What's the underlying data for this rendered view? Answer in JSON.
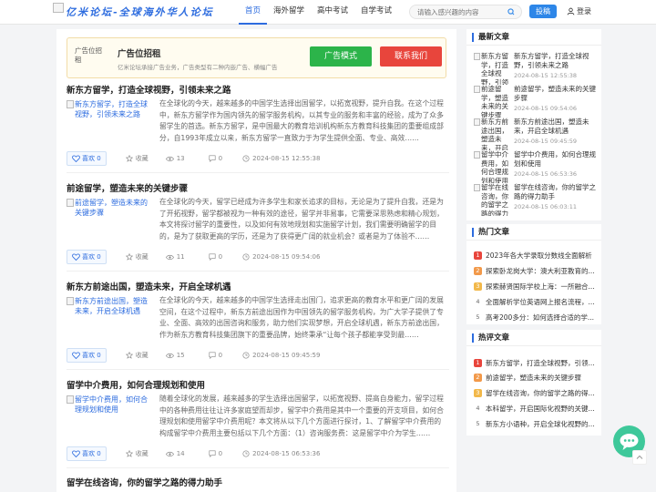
{
  "header": {
    "logo_text": "亿米论坛-全球海外华人论坛",
    "nav": [
      {
        "label": "首页",
        "active": true
      },
      {
        "label": "海外留学",
        "active": false
      },
      {
        "label": "高中考试",
        "active": false
      },
      {
        "label": "自学考试",
        "active": false
      }
    ],
    "search_placeholder": "请输入感兴趣的内容",
    "post_label": "投稿",
    "login_label": "登录"
  },
  "ad": {
    "image_alt": "广告位招租",
    "title": "广告位招租",
    "desc": "亿米论坛承接广告业务，广告类型有二种内嵌广告、横幅广告",
    "btn_mode": "广告模式",
    "btn_contact": "联系我们"
  },
  "articles": [
    {
      "title": "新东方留学，打造全球视野，引领未来之路",
      "image_alt": "新东方留学，打造全球视野，引领未来之路",
      "summary": "在全球化的今天，越来越多的中国学生选择出国留学，以拓宽视野，提升自我。在这个过程中，新东方留学作为国内领先的留学服务机构，以其专业的服务和丰富的经验，成为了众多留学生的首选。新东方留学，是中国最大的教育培训机构新东方教育科技集团的重要组成部分，自1993年成立以来，新东方留学一直致力于为学生提供全面、专业、高效……",
      "likes": "喜欢 0",
      "fav": "收藏",
      "views": "13",
      "comments": "0",
      "time": "2024-08-15 12:55:38"
    },
    {
      "title": "前途留学，塑造未来的关键步骤",
      "image_alt": "前途留学，塑造未来的关键步骤",
      "summary": "在全球化的今天，留学已经成为许多学生和家长追求的目标，无论是为了提升自我，还是为了开拓视野，留学都被视为一种有效的途径，留学并非易事，它需要深思熟虑和精心规划，本文将探讨留学的重要性，以及如何有效地规划和实施留学计划，我们需要明确留学的目的，是为了获取更高的学历，还是为了获得更广阔的就业机会？或者是为了体验不……",
      "likes": "喜欢 0",
      "fav": "收藏",
      "views": "11",
      "comments": "0",
      "time": "2024-08-15 09:54:06"
    },
    {
      "title": "新东方前途出国，塑造未来，开启全球机遇",
      "image_alt": "新东方前途出国，塑造未来，开启全球机遇",
      "summary": "在全球化的今天，越来越多的中国学生选择走出国门，追求更高的教育水平和更广阔的发展空间，在这个过程中，新东方前途出国作为中国领先的留学服务机构，为广大学子提供了专业、全面、高效的出国咨询和服务，助力他们实现梦想，开启全球机遇，新东方前途出国，作为新东方教育科技集团旗下的重要品牌，始终秉承“让每个孩子都能享受到最……",
      "likes": "喜欢 0",
      "fav": "收藏",
      "views": "15",
      "comments": "0",
      "time": "2024-08-15 09:45:59"
    },
    {
      "title": "留学中介费用，如何合理规划和使用",
      "image_alt": "留学中介费用，如何合理规划和使用",
      "summary": "随着全球化的发展，越来越多的学生选择出国留学，以拓宽视野、提高自身能力，留学过程中的各种费用往往让许多家庭望而却步，留学中介费用是其中一个重要的开支项目，如何合理规划和使用留学中介费用呢？本文将从以下几个方面进行探讨，1、了解留学中介费用的构成留学中介费用主要包括以下几个方面：（1）咨询服务费：这是留学中介为学生……",
      "likes": "喜欢 0",
      "fav": "收藏",
      "views": "14",
      "comments": "0",
      "time": "2024-08-15 06:53:36"
    },
    {
      "title": "留学在线咨询，你的留学之路的得力助手"
    }
  ],
  "sidebar": {
    "latest_title": "最新文章",
    "latest": [
      {
        "title": "新东方留学，打造全球视野，引领未来之路",
        "date": "2024-08-15 12:55:38"
      },
      {
        "title": "前途留学，塑造未来的关键步骤",
        "date": "2024-08-15 09:54:06"
      },
      {
        "title": "新东方前途出国，塑造未来，开启全球机遇",
        "date": "2024-08-15 09:45:59"
      },
      {
        "title": "留学中介费用，如何合理规划和使用",
        "date": "2024-08-15 06:53:36"
      },
      {
        "title": "留学在线咨询，你的留学之路的得力助手",
        "date": "2024-08-15 06:03:11"
      }
    ],
    "hot_title": "热门文章",
    "hot": [
      {
        "num": "1",
        "text": "2023年各大学录取分数线全面解析"
      },
      {
        "num": "2",
        "text": "探索卧龙岗大学：澳大利亚教育的..."
      },
      {
        "num": "3",
        "text": "探索赫贤国际学校上海：一所融合..."
      },
      {
        "num": "4",
        "text": "全面解析学位英语网上报名流程，..."
      },
      {
        "num": "5",
        "text": "高考200多分：如何选择合适的学..."
      }
    ],
    "comment_title": "热评文章",
    "comment": [
      {
        "num": "1",
        "text": "新东方留学，打造全球视野，引领..."
      },
      {
        "num": "2",
        "text": "前途留学，塑造未来的关键步骤"
      },
      {
        "num": "3",
        "text": "留学在线咨询，你的留学之路的得..."
      },
      {
        "num": "4",
        "text": "本科留学，开启国际化视野的关键..."
      },
      {
        "num": "5",
        "text": "新东方小语种，开启全球化视野的..."
      }
    ]
  },
  "colors": {
    "accent": "#2d6cdf",
    "rank1": "#e8453c",
    "rank2": "#f2994a",
    "rank3": "#f2b84a"
  }
}
